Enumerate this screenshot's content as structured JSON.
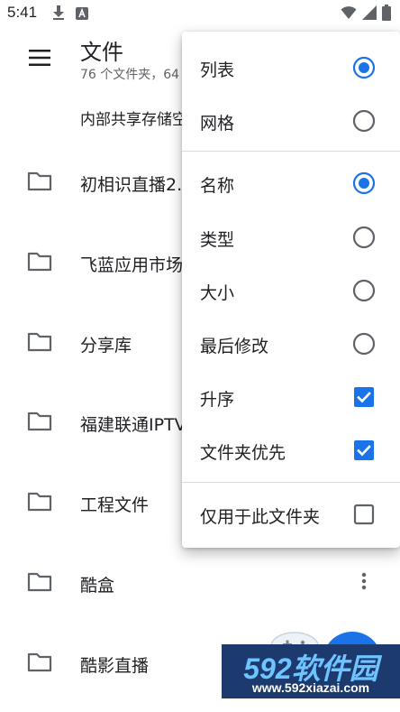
{
  "status_bar": {
    "time": "5:41",
    "icons": [
      "download-icon",
      "font-a-icon",
      "wifi-icon",
      "signal-icon",
      "battery-icon"
    ]
  },
  "app_bar": {
    "title": "文件",
    "subtitle": "76 个文件夹，64",
    "storage_label": "内部共享存储空"
  },
  "files": [
    {
      "name": "初相识直播2."
    },
    {
      "name": "飞蓝应用市场"
    },
    {
      "name": "分享库"
    },
    {
      "name": "福建联通IPTV"
    },
    {
      "name": "工程文件"
    },
    {
      "name": "酷盒"
    },
    {
      "name": "酷影直播"
    }
  ],
  "menu": {
    "view_options": [
      {
        "label": "列表",
        "selected": true
      },
      {
        "label": "网格",
        "selected": false
      }
    ],
    "sort_options": [
      {
        "label": "名称",
        "selected": true
      },
      {
        "label": "类型",
        "selected": false
      },
      {
        "label": "大小",
        "selected": false
      },
      {
        "label": "最后修改",
        "selected": false
      }
    ],
    "toggles": [
      {
        "label": "升序",
        "checked": true
      },
      {
        "label": "文件夹优先",
        "checked": true
      }
    ],
    "scope": {
      "label": "仅用于此文件夹",
      "checked": false
    }
  },
  "watermark": {
    "brand": "592软件园",
    "url": "www.592xiazai.com"
  },
  "colors": {
    "accent": "#1a73e8",
    "text_primary": "#202124",
    "text_secondary": "#5f6368",
    "control_off": "#5f6368",
    "divider": "#dadce0"
  }
}
